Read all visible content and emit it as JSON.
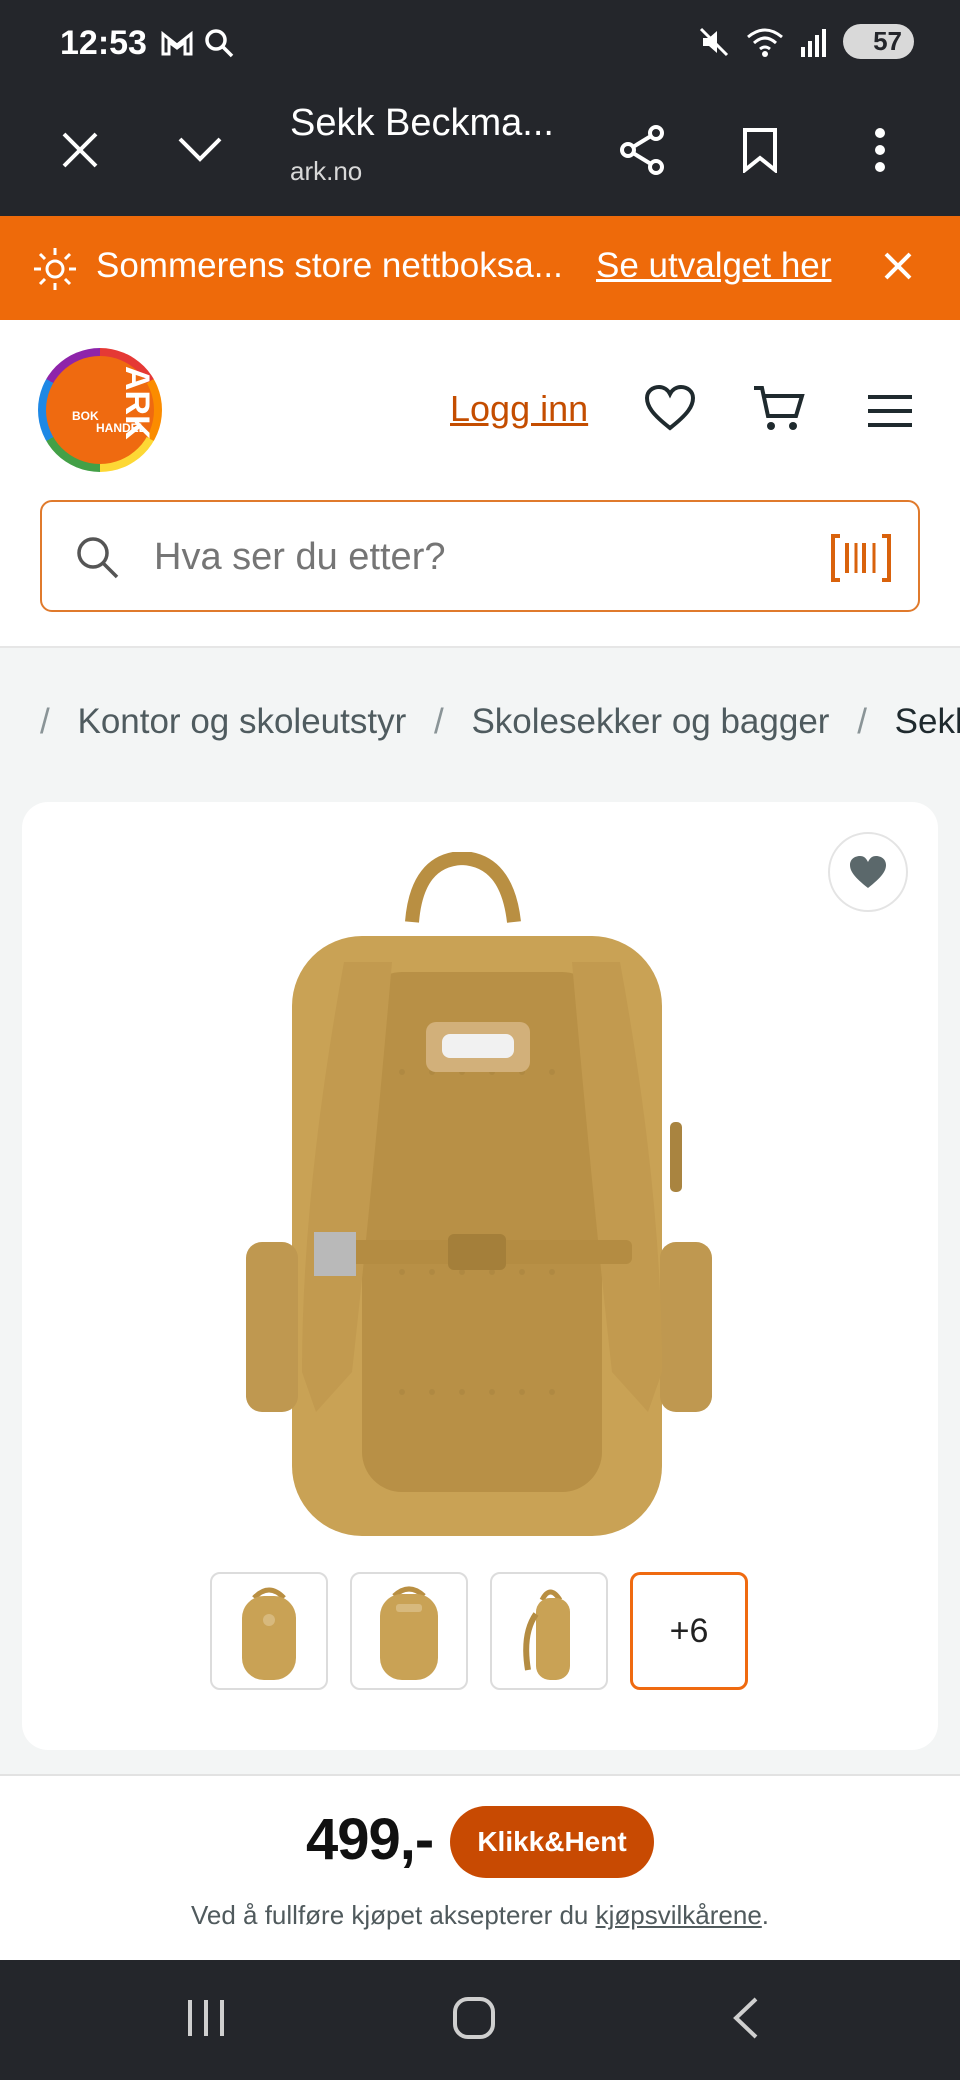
{
  "status_bar": {
    "time": "12:53",
    "battery": "57"
  },
  "browser": {
    "title": "Sekk Beckma...",
    "domain": "ark.no"
  },
  "promo": {
    "text": "Sommerens store nettboksa...",
    "link": "Se utvalget her"
  },
  "header": {
    "login": "Logg inn"
  },
  "search": {
    "placeholder": "Hva ser du etter?"
  },
  "breadcrumb": {
    "items": [
      "Kontor og skoleutstyr",
      "Skolesekker og bagger",
      "Sekk Beckmann"
    ]
  },
  "product": {
    "more_images": "+6",
    "price": "499,-",
    "cta": "Klikk&Hent",
    "terms_prefix": "Ved å fullføre kjøpet aksepterer du ",
    "terms_link": "kjøpsvilkårene",
    "terms_suffix": "."
  },
  "colors": {
    "accent": "#ee6a0a",
    "cta": "#c84a02",
    "dark": "#24262b",
    "backpack": "#c9a255"
  }
}
